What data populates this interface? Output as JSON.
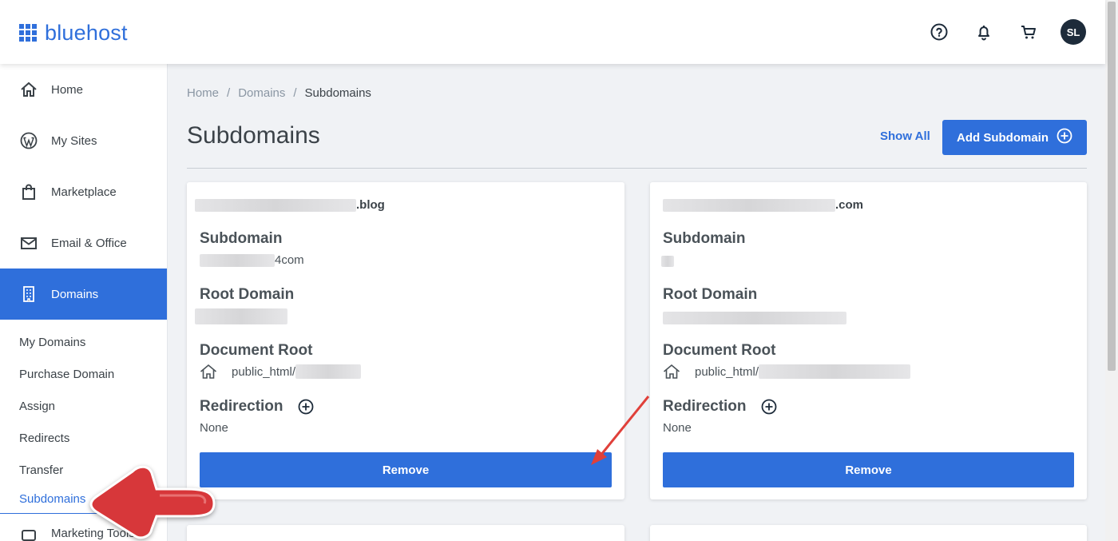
{
  "brand": {
    "name": "bluehost",
    "color": "#2f6fdb"
  },
  "header": {
    "icons": [
      "help-icon",
      "bell-icon",
      "cart-icon"
    ],
    "avatar_initials": "SL"
  },
  "sidebar": {
    "items": [
      {
        "label": "Home",
        "icon": "home-icon"
      },
      {
        "label": "My Sites",
        "icon": "wordpress-icon"
      },
      {
        "label": "Marketplace",
        "icon": "shopping-bag-icon"
      },
      {
        "label": "Email & Office",
        "icon": "envelope-icon"
      },
      {
        "label": "Domains",
        "icon": "building-icon",
        "active": true
      }
    ],
    "sub_items": [
      {
        "label": "My Domains"
      },
      {
        "label": "Purchase Domain"
      },
      {
        "label": "Assign"
      },
      {
        "label": "Redirects"
      },
      {
        "label": "Transfer"
      },
      {
        "label": "Subdomains",
        "active": true
      }
    ],
    "partial_item": {
      "label": "Marketing Tools",
      "icon": "marketing-icon"
    }
  },
  "breadcrumb": {
    "items": [
      "Home",
      "Domains",
      "Subdomains"
    ],
    "separator": "/"
  },
  "page": {
    "title": "Subdomains",
    "show_all_label": "Show All",
    "add_button_label": "Add Subdomain"
  },
  "labels": {
    "subdomain": "Subdomain",
    "root_domain": "Root Domain",
    "document_root": "Document Root",
    "redirection": "Redirection",
    "remove": "Remove"
  },
  "cards": [
    {
      "domain_suffix": ".blog",
      "subdomain_suffix": "4com",
      "document_root_prefix": "public_html/",
      "redirection": "None"
    },
    {
      "domain_suffix": ".com",
      "subdomain_suffix": "",
      "document_root_prefix": "public_html/",
      "redirection": "None"
    }
  ]
}
